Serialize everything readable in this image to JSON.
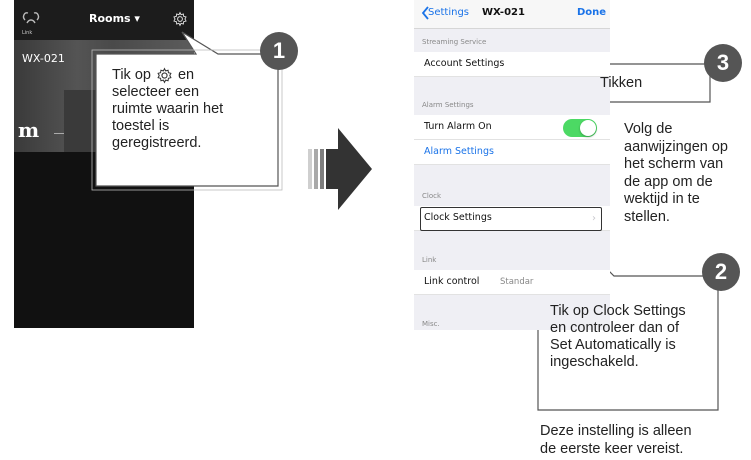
{
  "left_phone": {
    "link_label": "Link",
    "rooms_title": "Rooms ▾",
    "device_name": "WX-021",
    "logo_text": "m"
  },
  "right_phone": {
    "back_label": "Settings",
    "title": "WX-021",
    "done_label": "Done",
    "sections": {
      "streaming": "Streaming Service",
      "alarm": "Alarm Settings",
      "clock": "Clock",
      "link": "Link",
      "misc": "Misc."
    },
    "rows": {
      "account_settings": "Account Settings",
      "turn_alarm_on": "Turn Alarm On",
      "alarm_settings": "Alarm Settings",
      "clock_settings": "Clock Settings",
      "link_control": "Link control",
      "link_control_value": "Standar"
    },
    "alarm_toggle_on": true
  },
  "callouts": {
    "step1": {
      "number": "1",
      "line1_before": "Tik op",
      "line1_after": "en",
      "line2": "selecteer een",
      "line3": "ruimte waarin het",
      "line4": "toestel is",
      "line5": "geregistreerd."
    },
    "step3": {
      "number": "3",
      "text": "Tikken"
    },
    "step3_note": [
      "Volg de",
      "aanwijzingen op",
      "het scherm van",
      "de app om de",
      "wektijd in te",
      "stellen."
    ],
    "step2": {
      "number": "2",
      "lines": [
        "Tik op Clock Settings",
        "en controleer dan of",
        "Set Automatically is",
        "ingeschakeld."
      ]
    },
    "footnote": [
      "Deze instelling is alleen",
      "de eerste keer vereist."
    ]
  },
  "colors": {
    "badge": "#555555",
    "toggle_on": "#4cd964",
    "ios_blue": "#1a73e8"
  }
}
